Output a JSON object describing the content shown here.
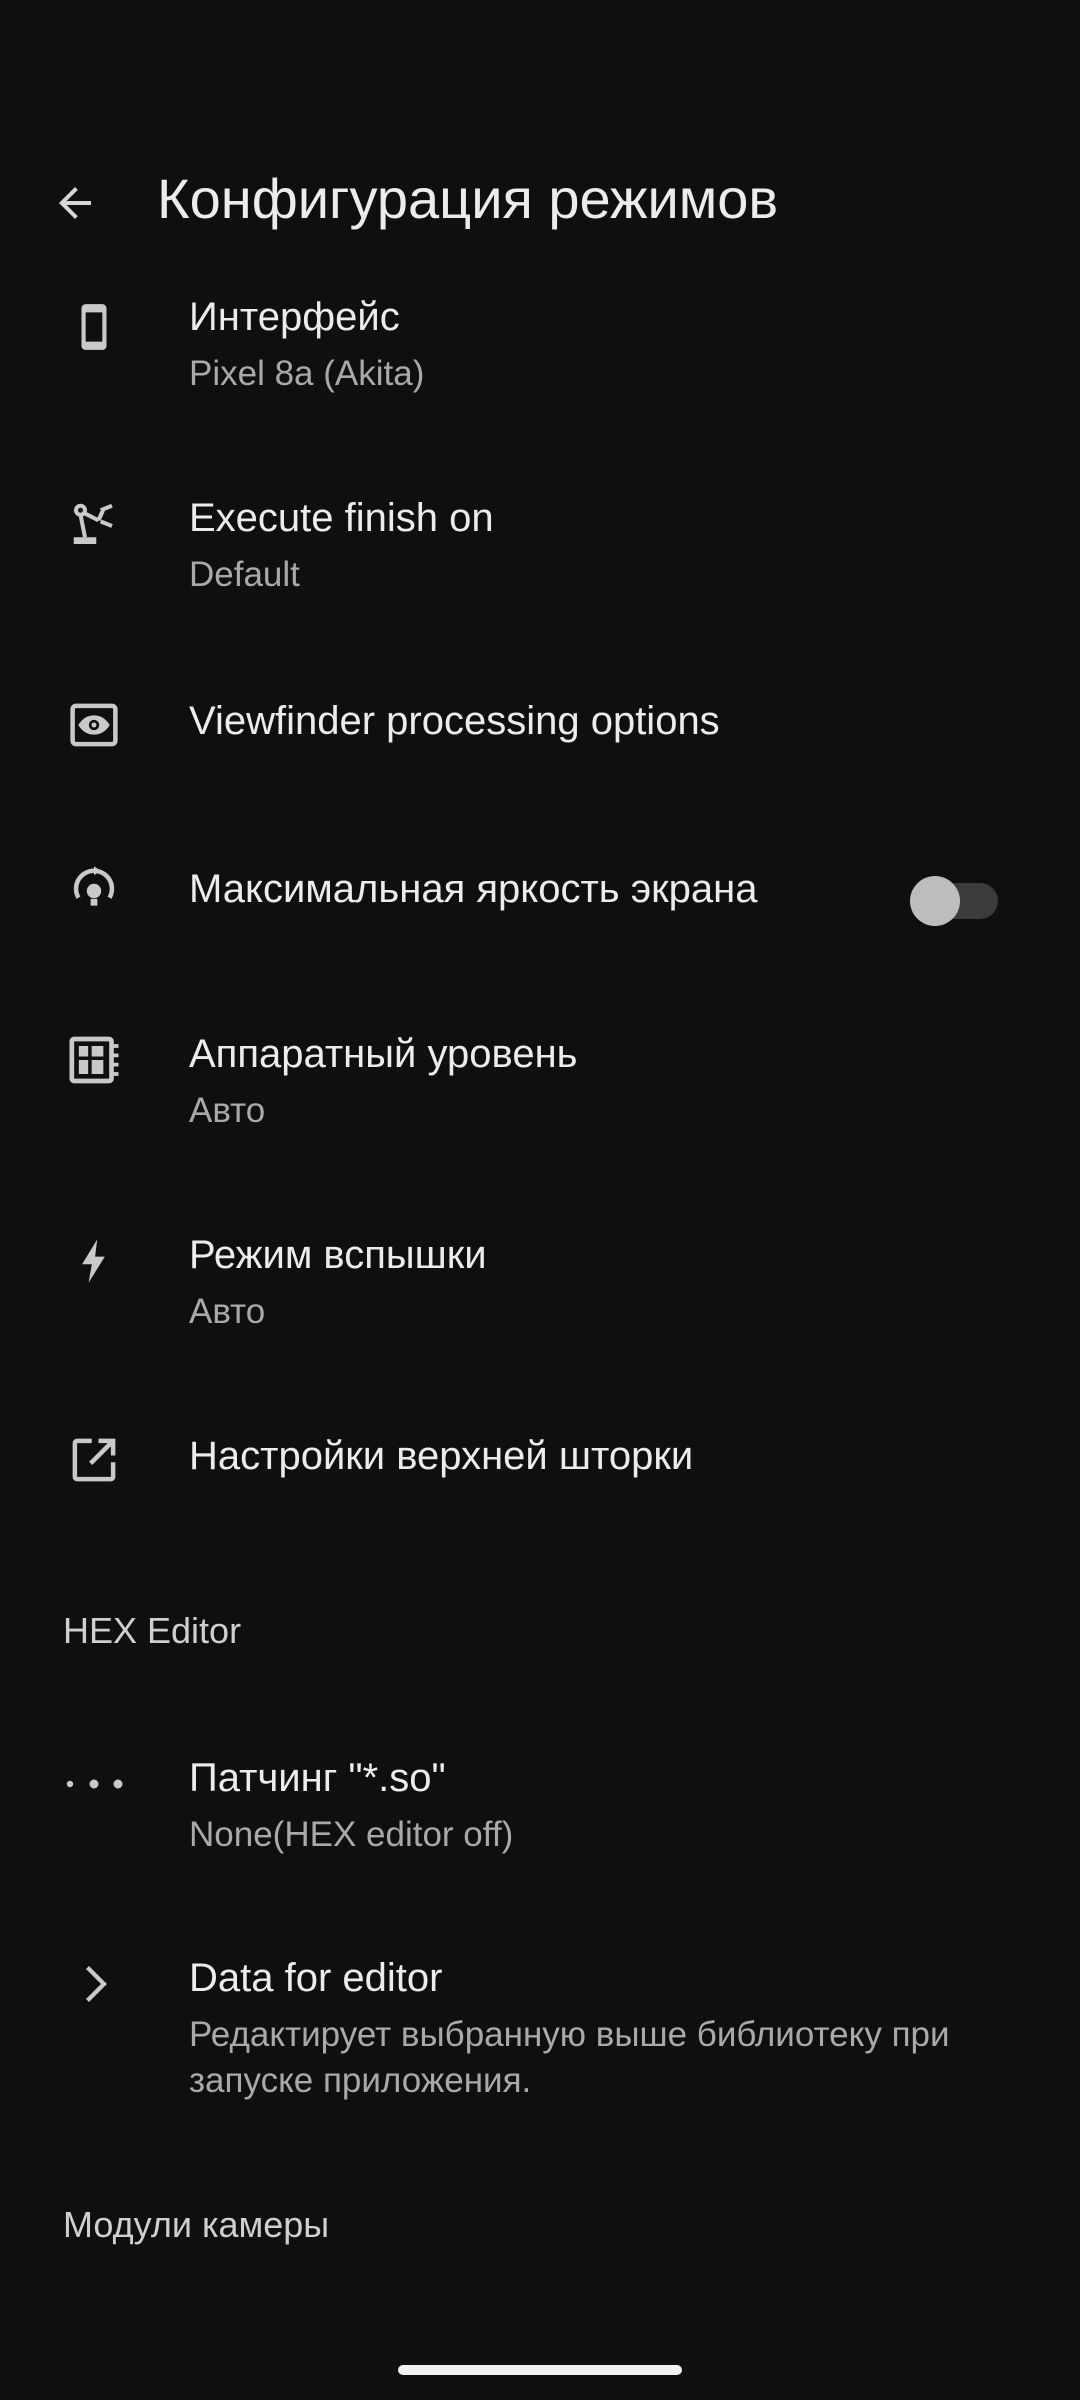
{
  "header": {
    "title": "Конфигурация режимов",
    "back_icon": "arrow-back-icon"
  },
  "settings": [
    {
      "id": "interface",
      "icon": "phone-icon",
      "label": "Интерфейс",
      "subtitle": "Pixel 8a (Akita)"
    },
    {
      "id": "execute-finish",
      "icon": "robot-arm-icon",
      "label": "Execute finish on",
      "subtitle": "Default"
    },
    {
      "id": "viewfinder",
      "icon": "eye-icon",
      "label": "Viewfinder processing options"
    },
    {
      "id": "max-brightness",
      "icon": "brightness-icon",
      "label": "Максимальная яркость экрана",
      "toggle": false
    },
    {
      "id": "hardware-level",
      "icon": "chip-icon",
      "label": "Аппаратный уровень",
      "subtitle": "Авто"
    },
    {
      "id": "flash-mode",
      "icon": "flash-icon",
      "label": "Режим вспышки",
      "subtitle": "Авто"
    },
    {
      "id": "shade-settings",
      "icon": "open-external-icon",
      "label": "Настройки верхней шторки"
    }
  ],
  "sections": {
    "hex_editor": "HEX Editor",
    "camera_modules": "Модули камеры"
  },
  "hex_settings": [
    {
      "id": "so-patching",
      "icon": "more-dots-icon",
      "label": "Патчинг \"*.so\"",
      "subtitle": "None(HEX editor off)"
    },
    {
      "id": "data-for-editor",
      "icon": "chevron-right-icon",
      "label": "Data for editor",
      "subtitle_line1": "Редактирует выбранную выше библиотеку при",
      "subtitle_line2": "запуске приложения."
    }
  ],
  "colors": {
    "background": "#0f0f0f",
    "text_primary": "#ececec",
    "text_secondary": "#a9a9a9"
  }
}
